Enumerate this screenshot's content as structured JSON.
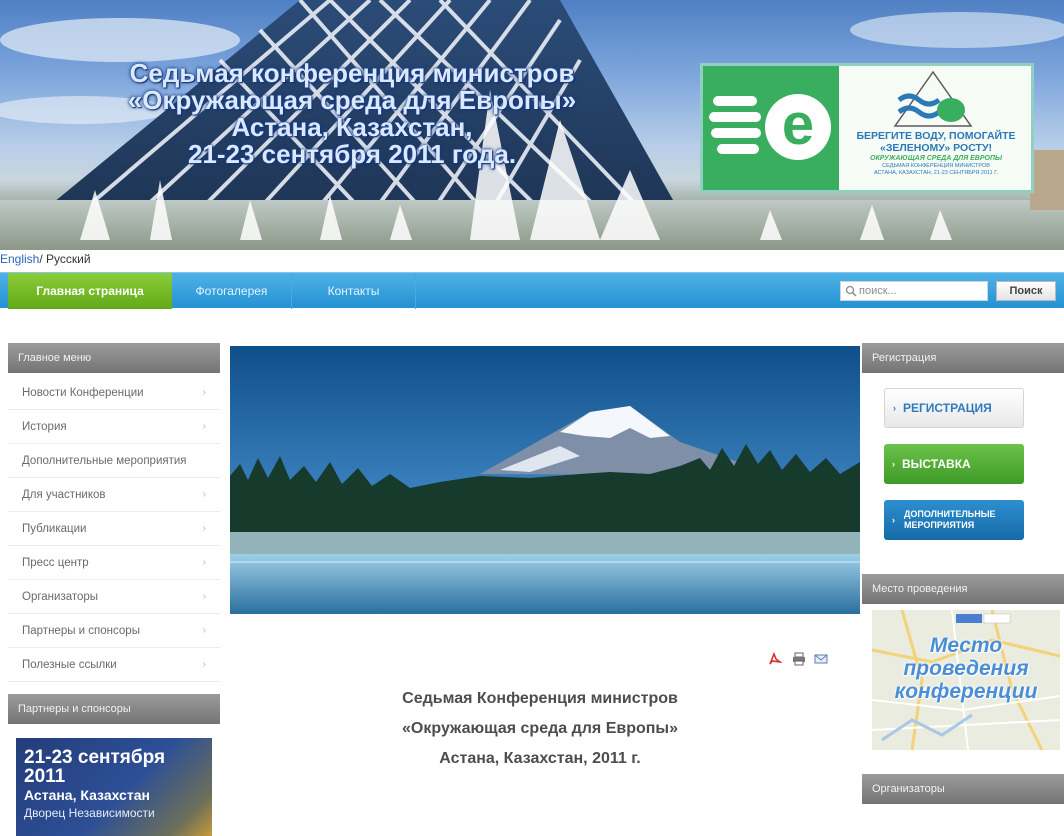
{
  "banner": {
    "title_lines": [
      "Седьмая конференция министров",
      "«Окружающая среда для Европы»",
      "Астана, Казахстан,",
      "21-23 сентября 2011 года."
    ],
    "logo": {
      "letter": "e",
      "slogan_line1": "БЕРЕГИТЕ ВОДУ, ПОМОГАЙТЕ",
      "slogan_line2": "«ЗЕЛЕНОМУ» РОСТУ!",
      "sub_line1": "ОКРУЖАЮЩАЯ СРЕДА ДЛЯ ЕВРОПЫ",
      "sub_line2": "СЕДЬМАЯ КОНФЕРЕНЦИЯ МИНИСТРОВ",
      "sub_line3": "АСТАНА, КАЗАХСТАН, 21-23 СЕНТЯБРЯ 2011 Г."
    }
  },
  "language": {
    "english": "English",
    "separator": "/ ",
    "russian": "Русский"
  },
  "nav": {
    "items": [
      {
        "label": "Главная страница"
      },
      {
        "label": "Фотогалерея"
      },
      {
        "label": "Контакты"
      }
    ],
    "search_placeholder": "поиск...",
    "search_button": "Поиск"
  },
  "left": {
    "menu_title": "Главное меню",
    "menu_items": [
      {
        "label": "Новости Конференции"
      },
      {
        "label": "История"
      },
      {
        "label": "Дополнительные мероприятия"
      },
      {
        "label": "Для участников"
      },
      {
        "label": "Публикации"
      },
      {
        "label": "Пресс центр"
      },
      {
        "label": "Организаторы"
      },
      {
        "label": "Партнеры и спонсоры"
      },
      {
        "label": "Полезные ссылки"
      }
    ],
    "partners_title": "Партнеры и спонсоры",
    "partners_banner": {
      "dates": "21-23 сентября",
      "year": "2011",
      "city": "Астана, Казахстан",
      "venue": "Дворец Независимости"
    }
  },
  "center": {
    "article_title_lines": [
      "Седьмая Конференция министров",
      "«Окружающая среда для Европы»",
      "Астана, Казахстан, 2011 г."
    ]
  },
  "right": {
    "registration_title": "Регистрация",
    "registration_button": "РЕГИСТРАЦИЯ",
    "exhibition_button": "ВЫСТАВКА",
    "events_button_line1": "ДОПОЛНИТЕЛЬНЫЕ",
    "events_button_line2": "МЕРОПРИЯТИЯ",
    "venue_title": "Место проведения",
    "venue_map_text": [
      "Место",
      "проведения",
      "конференции"
    ],
    "organizers_title": "Организаторы"
  },
  "colors": {
    "nav_blue": "#2391d2",
    "nav_active_green": "#62a918",
    "block_header_gray": "#7d7d7d",
    "expo_green": "#4ca932",
    "events_blue": "#1d78b8"
  }
}
